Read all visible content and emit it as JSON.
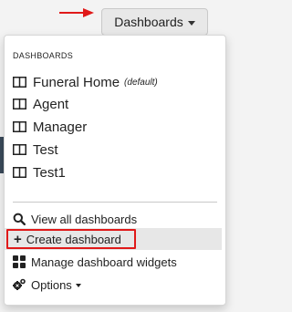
{
  "toolbar": {
    "dashboards_label": "Dashboards"
  },
  "menu": {
    "header": "DASHBOARDS",
    "dashboards": [
      {
        "label": "Funeral Home",
        "note": "(default)"
      },
      {
        "label": "Agent",
        "note": ""
      },
      {
        "label": "Manager",
        "note": ""
      },
      {
        "label": "Test",
        "note": ""
      },
      {
        "label": "Test1",
        "note": ""
      }
    ],
    "actions": {
      "view_all": "View all dashboards",
      "create": "Create dashboard",
      "manage_widgets": "Manage dashboard widgets",
      "options": "Options"
    }
  },
  "colors": {
    "highlight_border": "#e01919",
    "arrow": "#e01919"
  }
}
